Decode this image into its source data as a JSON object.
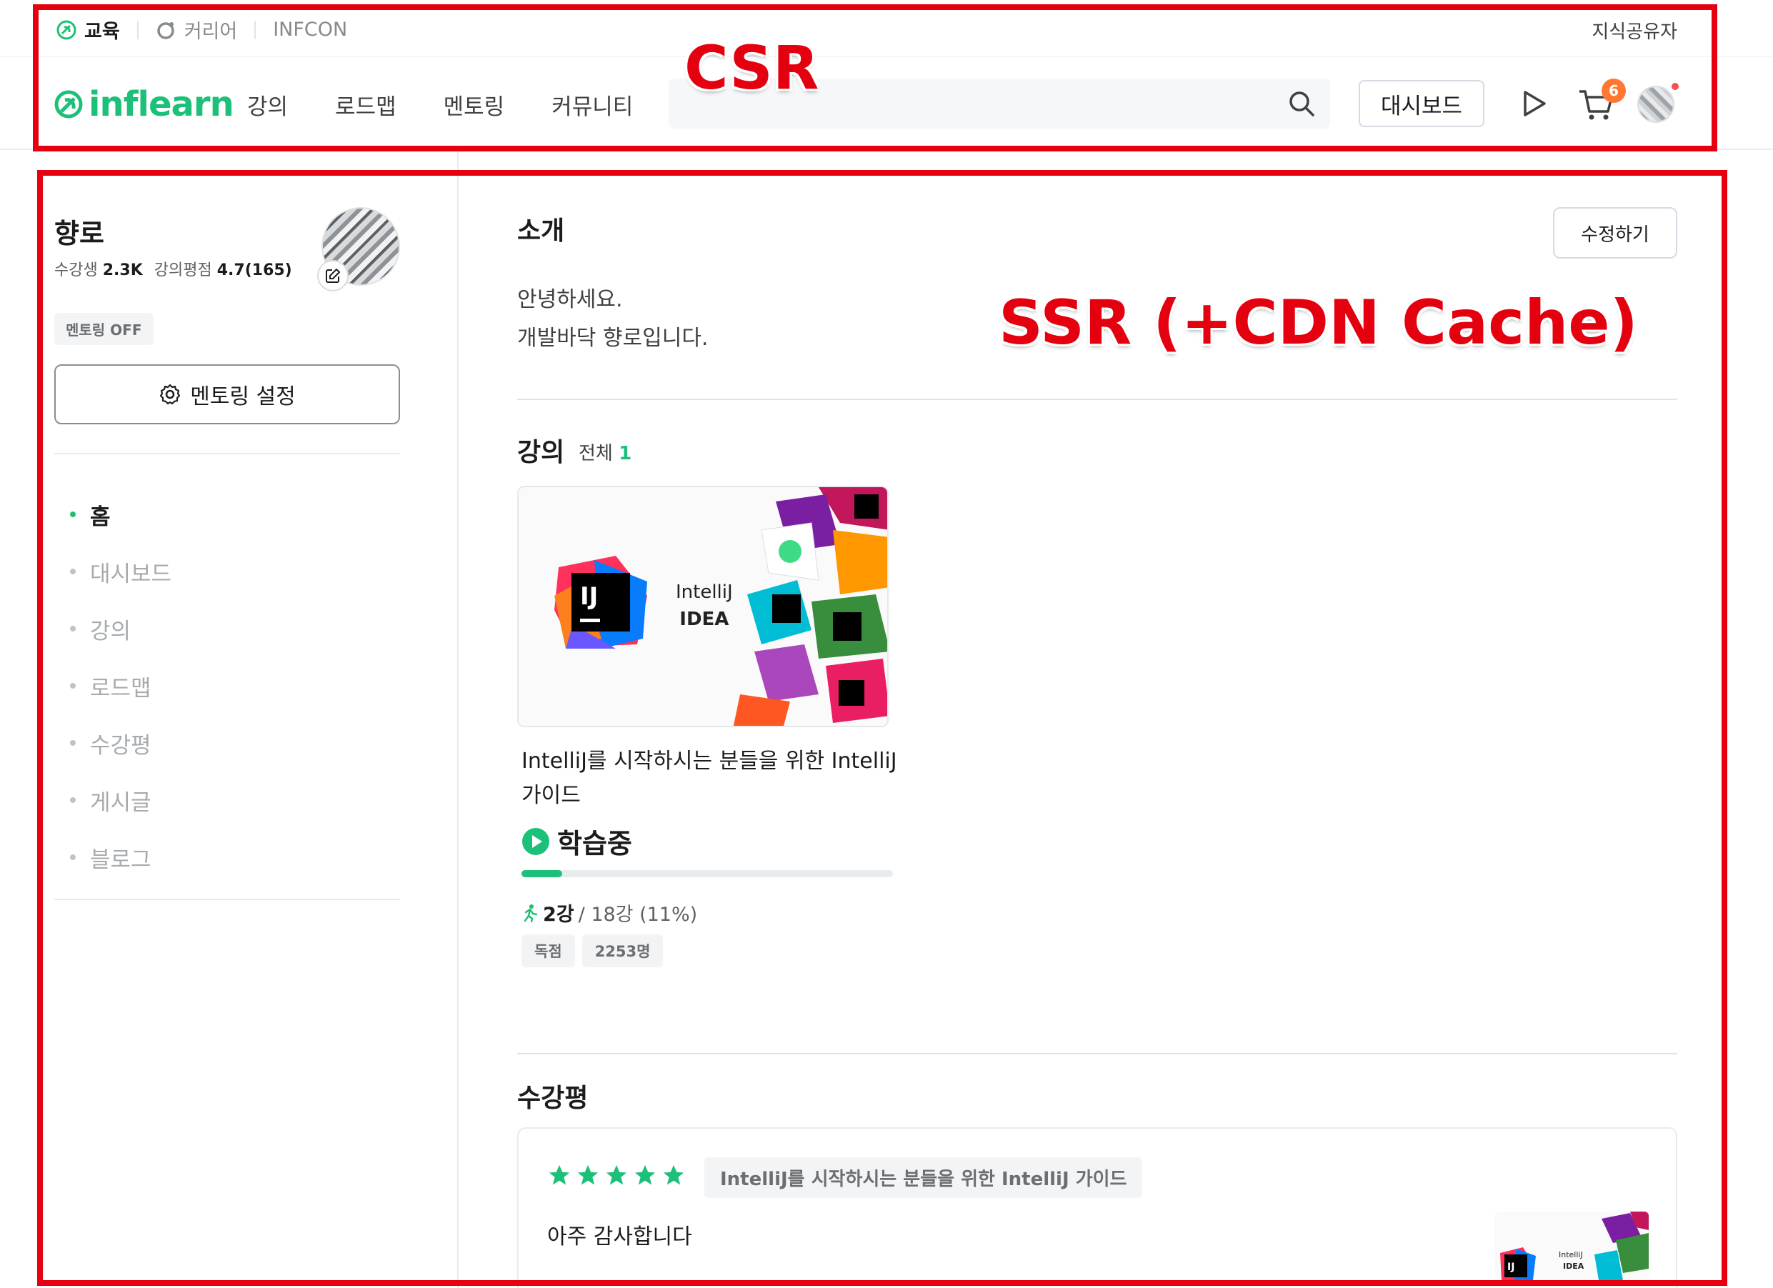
{
  "topbar": {
    "tabs": [
      {
        "label": "교육",
        "icon": "leaf-icon",
        "active": true
      },
      {
        "label": "커리어",
        "icon": "career-icon",
        "active": false
      },
      {
        "label": "INFCON",
        "icon": "",
        "active": false
      }
    ],
    "right_link": "지식공유자"
  },
  "nav": {
    "logo_text": "inflearn",
    "menu": [
      "강의",
      "로드맵",
      "멘토링",
      "커뮤니티"
    ],
    "search_placeholder": "",
    "dashboard_label": "대시보드",
    "cart_count": "6",
    "brand_color": "#1dc078"
  },
  "profile": {
    "name": "향로",
    "students_label": "수강생",
    "students_value": "2.3K",
    "rating_label": "강의평점",
    "rating_value": "4.7(165)",
    "mentoring_status": "멘토링 OFF",
    "mentoring_button": "멘토링 설정"
  },
  "sidebar_nav": [
    {
      "label": "홈",
      "active": true
    },
    {
      "label": "대시보드",
      "active": false
    },
    {
      "label": "강의",
      "active": false
    },
    {
      "label": "로드맵",
      "active": false
    },
    {
      "label": "수강평",
      "active": false
    },
    {
      "label": "게시글",
      "active": false
    },
    {
      "label": "블로그",
      "active": false
    }
  ],
  "intro": {
    "title": "소개",
    "edit_label": "수정하기",
    "lines": [
      "안녕하세요.",
      "개발바닥 향로입니다."
    ]
  },
  "courses": {
    "title": "강의",
    "total_label": "전체",
    "total_count": "1",
    "items": [
      {
        "thumb_line1": "IntelliJ",
        "thumb_line2": "IDEA",
        "thumb_logo": "IJ",
        "title": "IntelliJ를 시작하시는 분들을 위한 IntelliJ 가이드",
        "status": "학습중",
        "progress_done": "2강",
        "progress_rest": "/ 18강 (11%)",
        "progress_fraction": 0.11,
        "tags": [
          "독점",
          "2253명"
        ]
      }
    ]
  },
  "reviews": {
    "title": "수강평",
    "items": [
      {
        "stars": 5,
        "course": "IntelliJ를 시작하시는 분들을 위한 IntelliJ 가이드",
        "text": "아주 감사합니다",
        "thumb_line1": "IntelliJ",
        "thumb_line2": "IDEA",
        "thumb_logo": "IJ"
      }
    ]
  },
  "annotations": {
    "csr_label": "CSR",
    "ssr_label": "SSR (+CDN Cache)",
    "color": "#e4000f"
  }
}
